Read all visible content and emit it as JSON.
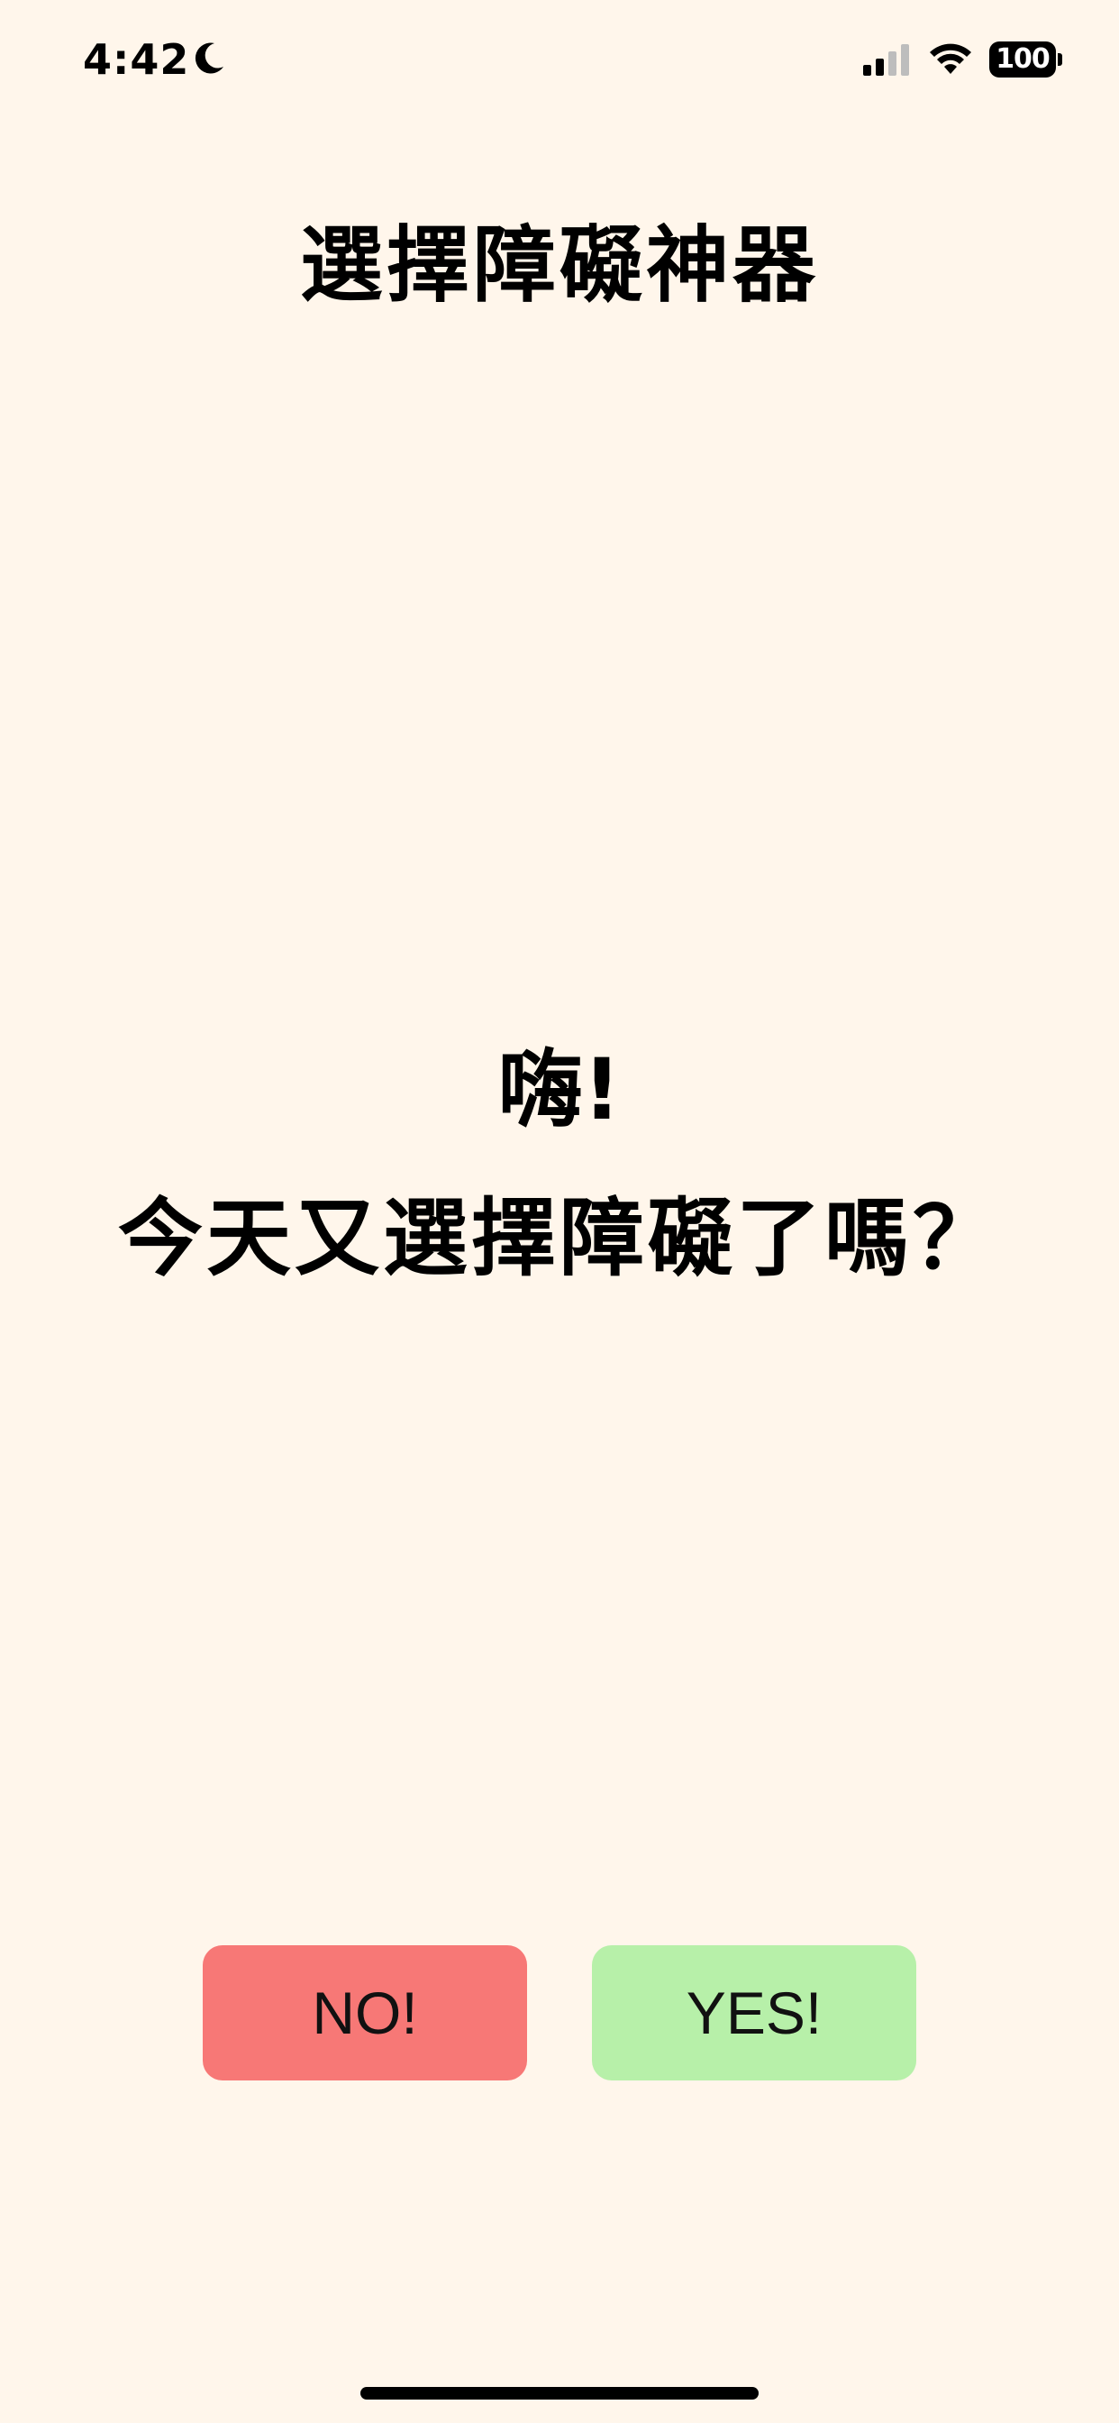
{
  "status_bar": {
    "time": "4:42",
    "battery": "100",
    "icons": [
      "moon-icon",
      "cellular-signal-icon",
      "wifi-icon",
      "battery-icon"
    ]
  },
  "header": {
    "title": "選擇障礙神器"
  },
  "main": {
    "greeting": "嗨!",
    "question": "今天又選擇障礙了嗎？"
  },
  "actions": {
    "no_label": "NO!",
    "yes_label": "YES!"
  },
  "colors": {
    "background": "#FFF6EB",
    "no_button": "#F77876",
    "yes_button": "#B7F0A9",
    "text": "#000000"
  }
}
